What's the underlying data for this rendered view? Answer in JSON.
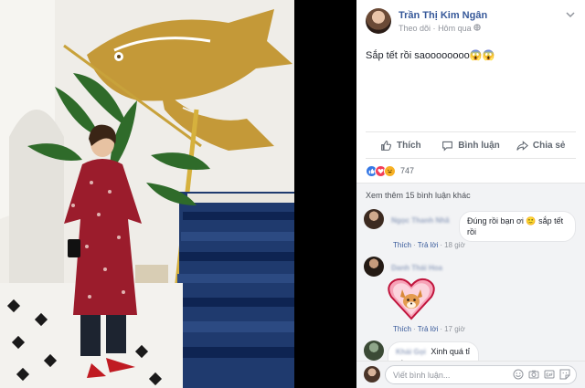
{
  "post": {
    "author": "Trần Thị Kim Ngân",
    "follow_label": "Theo dõi",
    "dot": "·",
    "time": "Hôm qua",
    "privacy_icon": "globe-icon",
    "text": "Sắp tết rồi saoooooooo😱😱"
  },
  "actions": {
    "like": "Thích",
    "comment": "Bình luận",
    "share": "Chia sẻ"
  },
  "reactions": {
    "icons": [
      "like-reaction-icon",
      "love-reaction-icon",
      "haha-reaction-icon"
    ],
    "count": "747"
  },
  "comments": {
    "more_label": "Xem thêm 15 bình luận khác",
    "items": [
      {
        "name": "Ngọc Thanh Nhã",
        "text": "Đúng rồi bạn ơi 🙂 sắp tết rồi",
        "like": "Thích",
        "reply": "Trả lời",
        "time": "18 giờ",
        "sep": "·"
      },
      {
        "name": "Danh Thái Hoa",
        "sticker": "heart-fox-sticker",
        "like": "Thích",
        "reply": "Trả lời",
        "time": "17 giờ",
        "sep": "·"
      },
      {
        "name": "Khải Gọi",
        "text": "Xinh quá tỉ ơi",
        "like": "",
        "reply": "",
        "time": ""
      }
    ]
  },
  "composer": {
    "placeholder": "Viết bình luận...",
    "icons": [
      "emoji-icon",
      "camera-icon",
      "gif-icon",
      "sticker-icon"
    ]
  },
  "colors": {
    "link": "#365899",
    "secondary_text": "#90949c",
    "comment_bg": "#f2f3f5"
  }
}
